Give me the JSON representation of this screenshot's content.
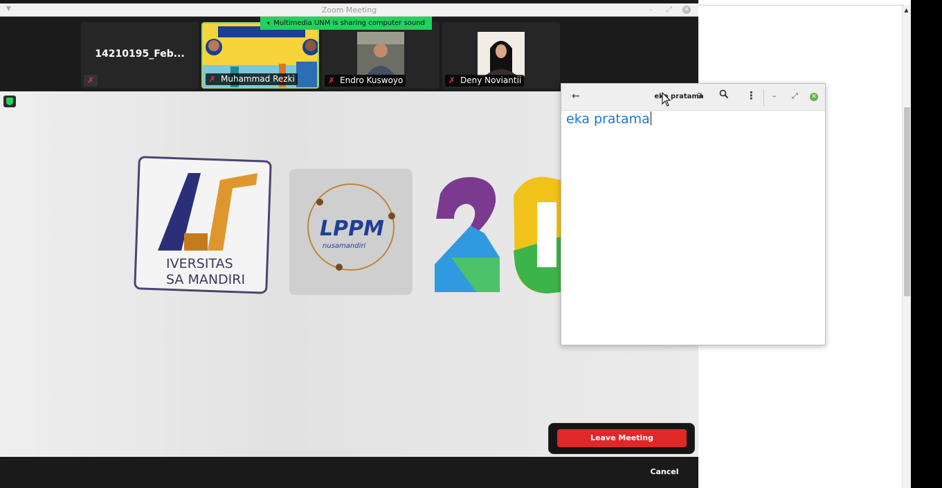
{
  "window": {
    "title": "Zoom Meeting"
  },
  "share_banner": "Multimedia UNM is sharing computer sound",
  "participants": [
    {
      "name": "14210195_Feb...",
      "muted": true
    },
    {
      "name": "Muhammad Rezki",
      "muted": true
    },
    {
      "name": "Endro Kuswoyo",
      "muted": true
    },
    {
      "name": "Deny Noviantii",
      "muted": true
    }
  ],
  "shared_content": {
    "logo1_text_line1": "IVERSITAS",
    "logo1_text_line2": "SA MANDIRI",
    "logo2_text": "LPPM",
    "logo2_subtext": "nusamandiri",
    "logo3_text": "20"
  },
  "leave_dialog": {
    "leave_label": "Leave Meeting",
    "cancel_label": "Cancel"
  },
  "editor": {
    "title": "eka pratama",
    "content": "eka pratama"
  },
  "colors": {
    "leave": "#e02828",
    "share_badge": "#23d160",
    "editor_text": "#1976d2"
  }
}
